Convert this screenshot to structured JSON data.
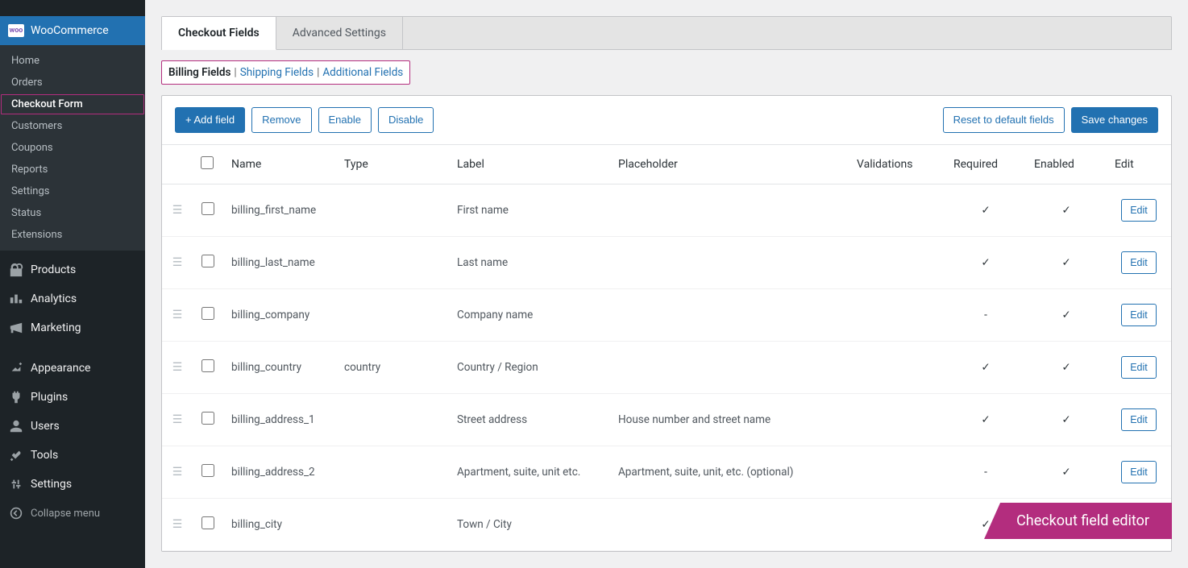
{
  "sidebar": {
    "active": {
      "label": "WooCommerce"
    },
    "submenu": [
      {
        "label": "Home"
      },
      {
        "label": "Orders"
      },
      {
        "label": "Checkout Form",
        "current": true
      },
      {
        "label": "Customers"
      },
      {
        "label": "Coupons"
      },
      {
        "label": "Reports"
      },
      {
        "label": "Settings"
      },
      {
        "label": "Status"
      },
      {
        "label": "Extensions"
      }
    ],
    "main": [
      {
        "label": "Products",
        "icon": "products"
      },
      {
        "label": "Analytics",
        "icon": "analytics"
      },
      {
        "label": "Marketing",
        "icon": "marketing"
      }
    ],
    "lower": [
      {
        "label": "Appearance",
        "icon": "appearance"
      },
      {
        "label": "Plugins",
        "icon": "plugins"
      },
      {
        "label": "Users",
        "icon": "users"
      },
      {
        "label": "Tools",
        "icon": "tools"
      },
      {
        "label": "Settings",
        "icon": "settings"
      }
    ],
    "collapse": "Collapse menu"
  },
  "tabs": {
    "checkout_fields": "Checkout Fields",
    "advanced": "Advanced Settings"
  },
  "subtabs": {
    "billing": "Billing Fields",
    "shipping": "Shipping Fields",
    "additional": "Additional Fields"
  },
  "toolbar": {
    "add": "+ Add field",
    "remove": "Remove",
    "enable": "Enable",
    "disable": "Disable",
    "reset": "Reset to default fields",
    "save": "Save changes"
  },
  "table": {
    "headers": {
      "name": "Name",
      "type": "Type",
      "label": "Label",
      "placeholder": "Placeholder",
      "validations": "Validations",
      "required": "Required",
      "enabled": "Enabled",
      "edit": "Edit"
    },
    "rows": [
      {
        "name": "billing_first_name",
        "type": "",
        "label": "First name",
        "placeholder": "",
        "required": true,
        "enabled": true
      },
      {
        "name": "billing_last_name",
        "type": "",
        "label": "Last name",
        "placeholder": "",
        "required": true,
        "enabled": true
      },
      {
        "name": "billing_company",
        "type": "",
        "label": "Company name",
        "placeholder": "",
        "required": false,
        "enabled": true
      },
      {
        "name": "billing_country",
        "type": "country",
        "label": "Country / Region",
        "placeholder": "",
        "required": true,
        "enabled": true
      },
      {
        "name": "billing_address_1",
        "type": "",
        "label": "Street address",
        "placeholder": "House number and street name",
        "required": true,
        "enabled": true
      },
      {
        "name": "billing_address_2",
        "type": "",
        "label": "Apartment, suite, unit etc.",
        "placeholder": "Apartment, suite, unit, etc. (optional)",
        "required": false,
        "enabled": true
      },
      {
        "name": "billing_city",
        "type": "",
        "label": "Town / City",
        "placeholder": "",
        "required": true,
        "enabled": true
      }
    ],
    "edit_label": "Edit"
  },
  "banner": "Checkout field editor"
}
